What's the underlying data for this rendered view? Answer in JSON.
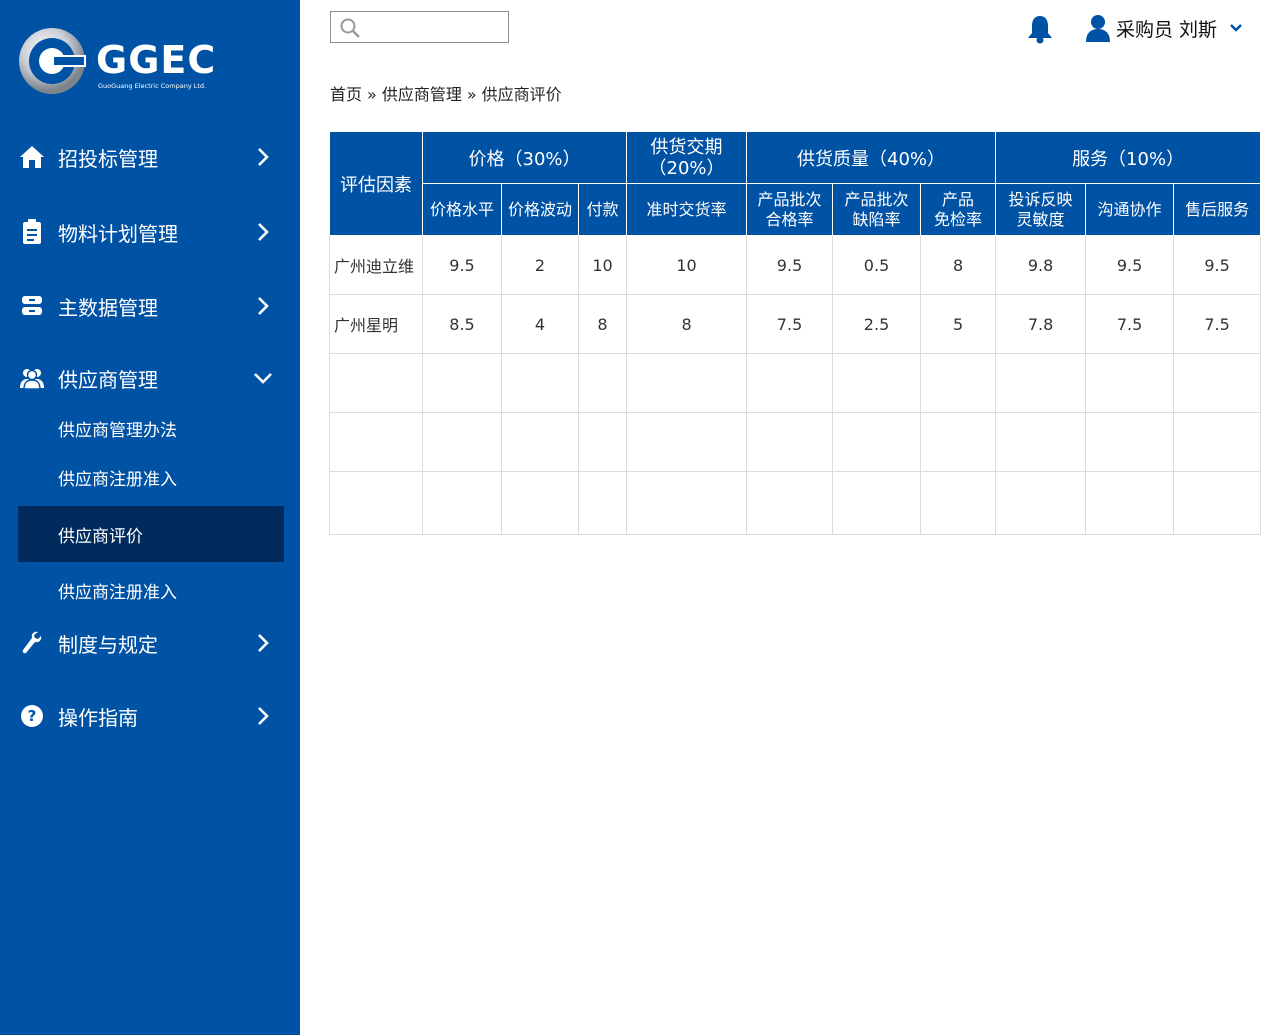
{
  "brand": {
    "name": "GGEC",
    "subtitle": "GuoGuang Electric Company Ltd."
  },
  "sidebar": {
    "items": [
      {
        "label": "招投标管理",
        "icon": "home-icon"
      },
      {
        "label": "物料计划管理",
        "icon": "clipboard-icon"
      },
      {
        "label": "主数据管理",
        "icon": "database-icon"
      },
      {
        "label": "供应商管理",
        "icon": "users-icon"
      },
      {
        "label": "制度与规定",
        "icon": "wrench-icon"
      },
      {
        "label": "操作指南",
        "icon": "help-icon"
      }
    ],
    "supplier_subitems": [
      {
        "label": "供应商管理办法"
      },
      {
        "label": "供应商注册准入"
      },
      {
        "label": "供应商评价"
      },
      {
        "label": "供应商注册准入"
      }
    ]
  },
  "search": {
    "placeholder": "",
    "value": ""
  },
  "user": {
    "label": "采购员  刘斯"
  },
  "breadcrumb": {
    "home": "首页",
    "sep": "»",
    "level1": "供应商管理",
    "current": "供应商评价"
  },
  "table": {
    "factor_header": "评估因素",
    "groups": [
      {
        "label": "价格（30%）"
      },
      {
        "label_line1": "供货交期",
        "label_line2": "（20%）"
      },
      {
        "label": "供货质量（40%）"
      },
      {
        "label": "服务（10%）"
      }
    ],
    "subheaders": [
      {
        "line1": "价格水平",
        "line2": ""
      },
      {
        "line1": "价格波动",
        "line2": ""
      },
      {
        "line1": "付款",
        "line2": ""
      },
      {
        "line1": "准时交货率",
        "line2": ""
      },
      {
        "line1": "产品批次",
        "line2": "合格率"
      },
      {
        "line1": "产品批次",
        "line2": "缺陷率"
      },
      {
        "line1": "产品",
        "line2": "免检率"
      },
      {
        "line1": "投诉反映",
        "line2": "灵敏度"
      },
      {
        "line1": "沟通协作",
        "line2": ""
      },
      {
        "line1": "售后服务",
        "line2": ""
      }
    ],
    "rows": [
      {
        "name": "广州迪立维",
        "values": [
          "9.5",
          "2",
          "10",
          "10",
          "9.5",
          "0.5",
          "8",
          "9.8",
          "9.5",
          "9.5"
        ]
      },
      {
        "name": "广州星明",
        "values": [
          "8.5",
          "4",
          "8",
          "8",
          "7.5",
          "2.5",
          "5",
          "7.8",
          "7.5",
          "7.5"
        ]
      },
      {
        "name": "",
        "values": [
          "",
          "",
          "",
          "",
          "",
          "",
          "",
          "",
          "",
          ""
        ]
      },
      {
        "name": "",
        "values": [
          "",
          "",
          "",
          "",
          "",
          "",
          "",
          "",
          "",
          ""
        ]
      },
      {
        "name": "",
        "values": [
          "",
          "",
          "",
          "",
          "",
          "",
          "",
          "",
          "",
          ""
        ]
      }
    ]
  },
  "colors": {
    "sidebar": "#0052a5",
    "active": "#002b5c",
    "header": "#0052a5"
  }
}
